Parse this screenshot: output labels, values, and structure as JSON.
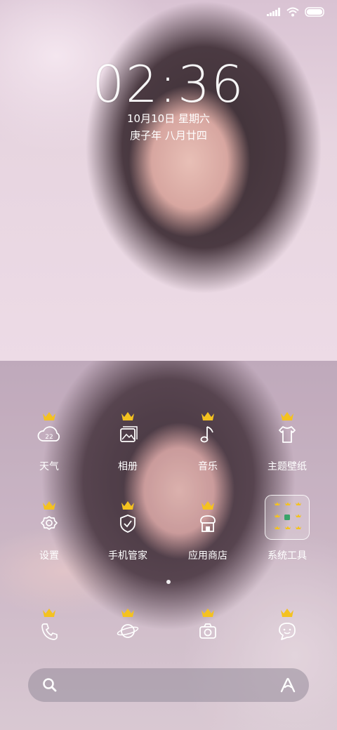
{
  "lockscreen": {
    "time": "02:36",
    "date": "10月10日 星期六",
    "lunar": "庚子年 八月廿四"
  },
  "status_icons": [
    "signal-icon",
    "wifi-icon",
    "battery-icon"
  ],
  "apps_row1": [
    {
      "label": "天气",
      "icon": "weather-icon",
      "badge": "22"
    },
    {
      "label": "相册",
      "icon": "gallery-icon"
    },
    {
      "label": "音乐",
      "icon": "music-icon"
    },
    {
      "label": "主题壁纸",
      "icon": "theme-icon"
    }
  ],
  "apps_row2": [
    {
      "label": "设置",
      "icon": "settings-icon"
    },
    {
      "label": "手机管家",
      "icon": "security-icon"
    },
    {
      "label": "应用商店",
      "icon": "app-store-icon"
    },
    {
      "label": "系统工具",
      "icon": "folder-icon"
    }
  ],
  "dock": [
    {
      "icon": "phone-icon"
    },
    {
      "icon": "browser-icon"
    },
    {
      "icon": "camera-icon"
    },
    {
      "icon": "messages-icon"
    }
  ],
  "search_icon": "search-icon",
  "assistant_icon": "assistant-icon",
  "colors": {
    "crown": "#f4c21f",
    "text": "#ffffff"
  }
}
